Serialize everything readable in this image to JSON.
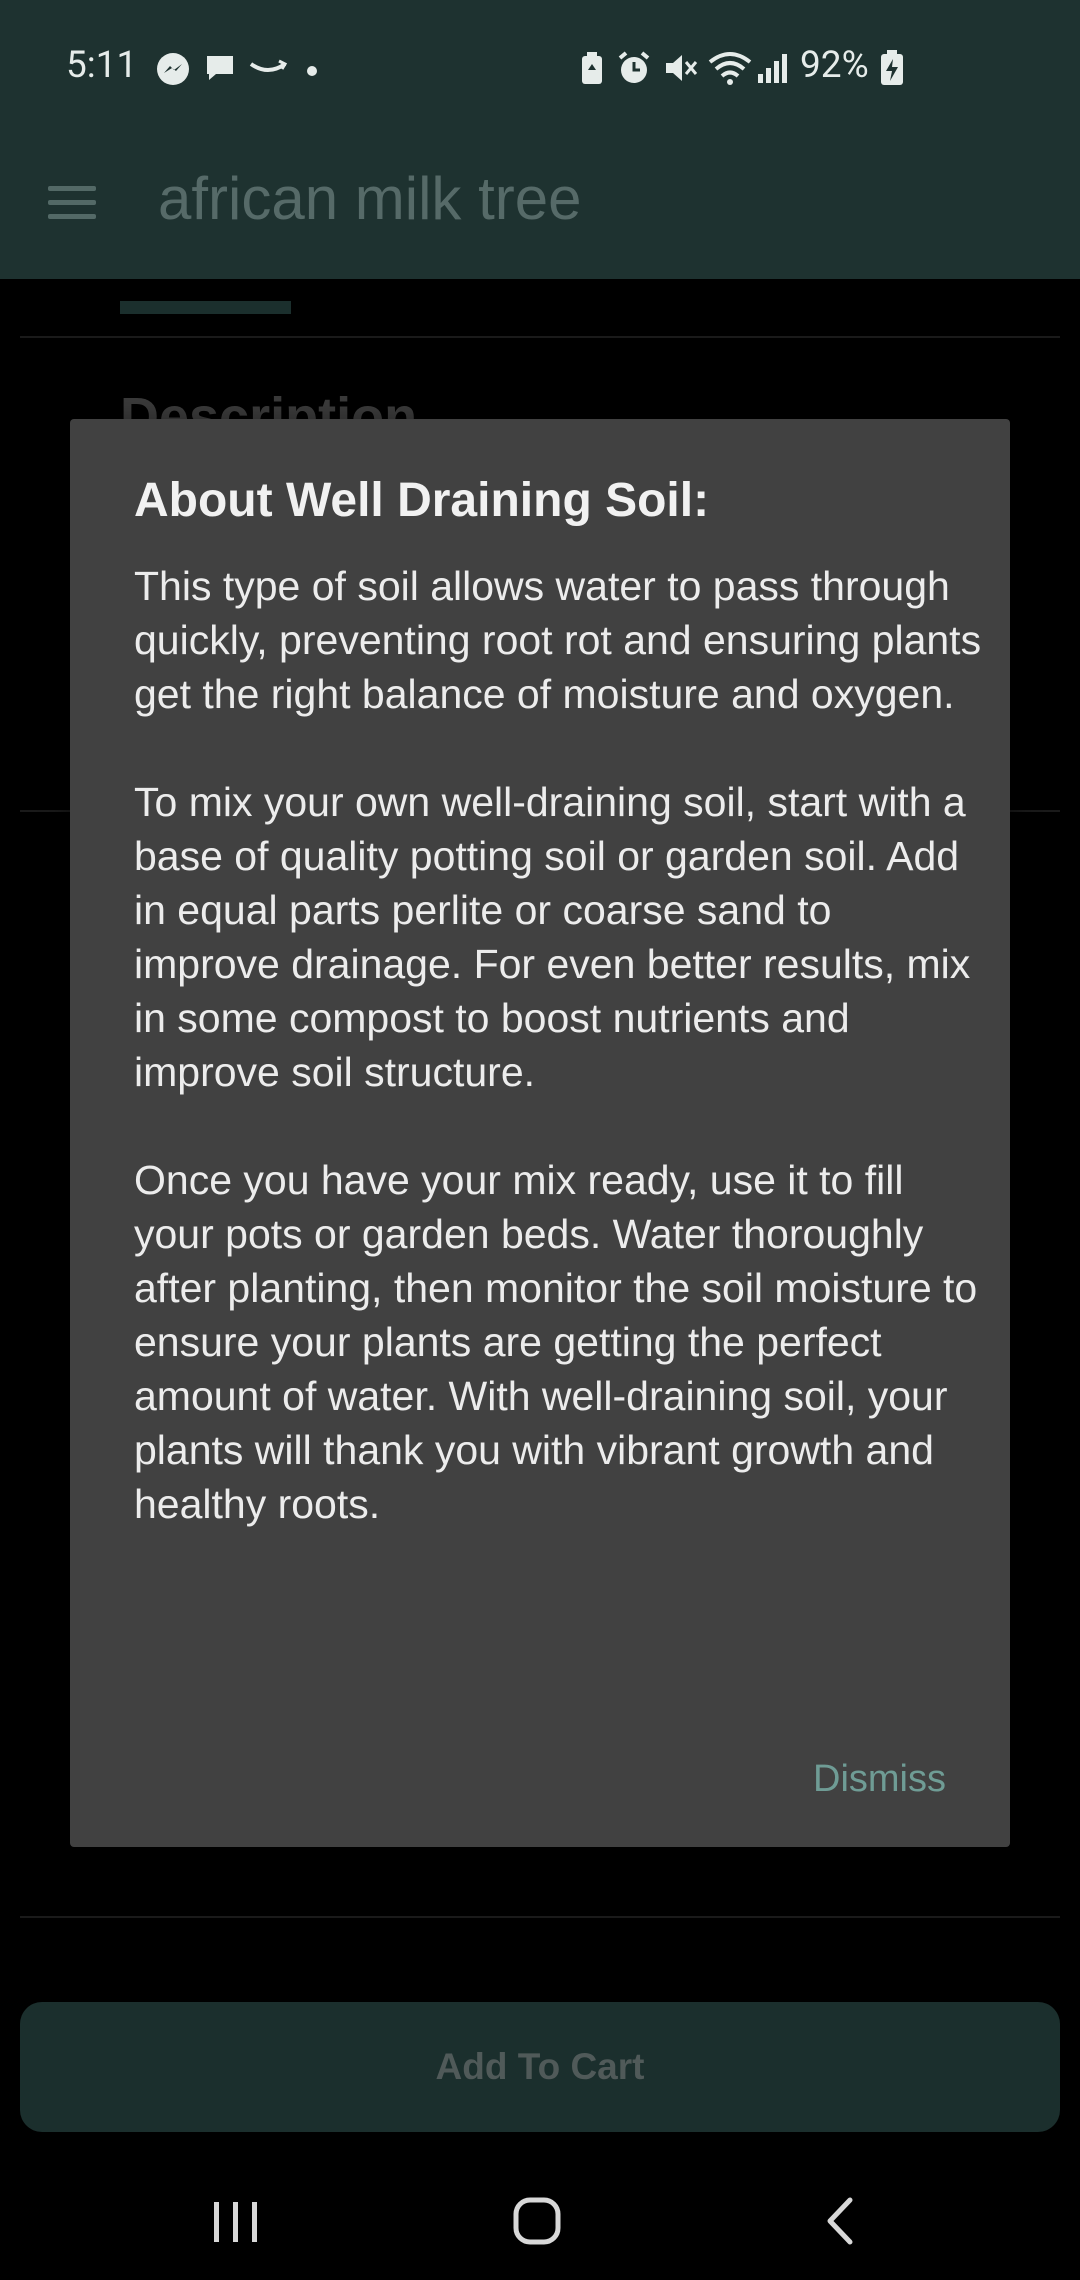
{
  "status_bar": {
    "time": "5:11",
    "battery": "92%",
    "left_icons": [
      "messenger-icon",
      "chat-icon",
      "amazon-icon",
      "dot-icon"
    ],
    "right_icons": [
      "recycle-icon",
      "alarm-icon",
      "mute-icon",
      "wifi-icon",
      "signal-icon",
      "battery-charging-icon"
    ]
  },
  "app_bar": {
    "title": "african milk tree",
    "menu_icon": "hamburger-menu-icon"
  },
  "background": {
    "section_title": "Description"
  },
  "dialog": {
    "title": "About Well Draining Soil:",
    "paragraphs": [
      "This type of soil allows water to pass through quickly, preventing root rot and ensuring plants get the right balance of moisture and oxygen.",
      "To mix your own well-draining soil, start with a base of quality potting soil or garden soil. Add in equal parts perlite or coarse sand to improve drainage. For even better results, mix in some compost to boost nutrients and improve soil structure.",
      "Once you have your mix ready, use it to fill your pots or garden beds. Water thoroughly after planting, then monitor the soil moisture to ensure your plants are getting the perfect amount of water. With well-draining soil, your plants will thank you with vibrant growth and healthy roots."
    ],
    "dismiss_label": "Dismiss"
  },
  "cart": {
    "button_label": "Add To Cart"
  },
  "nav_bar": {
    "icons": [
      "recent-apps-icon",
      "home-icon",
      "back-icon"
    ]
  },
  "colors": {
    "primary_dark": "#1e3230",
    "dialog_bg": "#414141",
    "accent": "#6f9c95"
  }
}
